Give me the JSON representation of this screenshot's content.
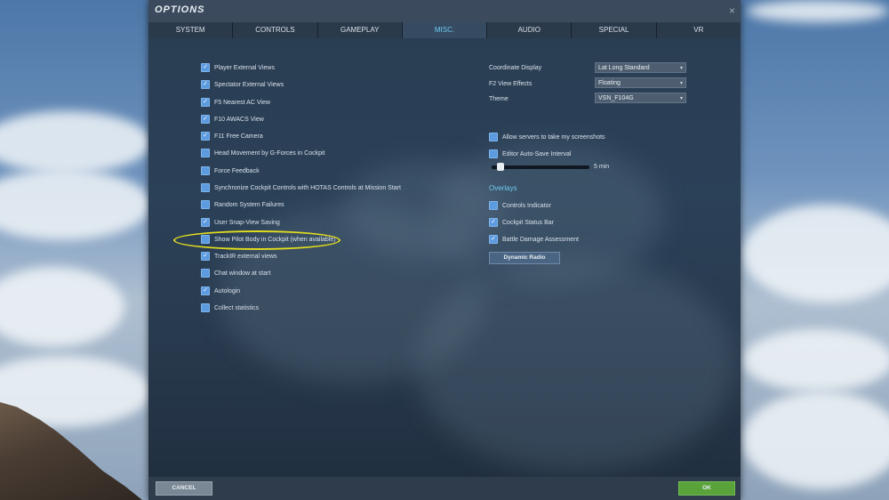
{
  "window": {
    "title": "OPTIONS",
    "close_glyph": "×"
  },
  "tabs": [
    {
      "label": "SYSTEM"
    },
    {
      "label": "CONTROLS"
    },
    {
      "label": "GAMEPLAY"
    },
    {
      "label": "MISC."
    },
    {
      "label": "AUDIO"
    },
    {
      "label": "SPECIAL"
    },
    {
      "label": "VR"
    }
  ],
  "active_tab": "MISC.",
  "left_options": [
    {
      "label": "Player External Views",
      "checked": true
    },
    {
      "label": "Spectator External Views",
      "checked": true
    },
    {
      "label": "F5 Nearest AC View",
      "checked": true
    },
    {
      "label": "F10 AWACS View",
      "checked": true
    },
    {
      "label": "F11 Free Camera",
      "checked": true
    },
    {
      "label": "Head Movement by G-Forces in Cockpit",
      "checked": false
    },
    {
      "label": "Force Feedback",
      "checked": false
    },
    {
      "label": "Synchronize Cockpit Controls with HOTAS Controls at Mission Start",
      "checked": false
    },
    {
      "label": "Random System Failures",
      "checked": false
    },
    {
      "label": "User Snap-View Saving",
      "checked": true
    },
    {
      "label": "Show Pilot Body in Cockpit (when available)",
      "checked": false
    },
    {
      "label": "TrackIR external views",
      "checked": true
    },
    {
      "label": "Chat window at start",
      "checked": false
    },
    {
      "label": "Autologin",
      "checked": true
    },
    {
      "label": "Collect statistics",
      "checked": false
    }
  ],
  "dropdowns": [
    {
      "label": "Coordinate Display",
      "value": "Lat Long Standard"
    },
    {
      "label": "F2 View Effects",
      "value": "Floating"
    },
    {
      "label": "Theme",
      "value": "VSN_F104G"
    }
  ],
  "right_options": {
    "allow_screenshots": {
      "label": "Allow servers to take my screenshots",
      "checked": false
    },
    "editor_autosave": {
      "label": "Editor Auto-Save Interval",
      "checked": false
    },
    "slider_value_text": "5 min",
    "slider_fraction": 0.05
  },
  "overlays": {
    "title": "Overlays",
    "items": [
      {
        "label": "Controls Indicator",
        "checked": false
      },
      {
        "label": "Cockpit Status Bar",
        "checked": true
      },
      {
        "label": "Battle Damage Assessment",
        "checked": true
      }
    ],
    "dynamic_radio_label": "Dynamic Radio"
  },
  "footer": {
    "cancel_label": "CANCEL",
    "ok_label": "OK"
  },
  "colors": {
    "accent": "#6ec7f2",
    "checkbox": "#5c9be0",
    "ok": "#5aa33a",
    "highlight": "#e3dd1e"
  }
}
